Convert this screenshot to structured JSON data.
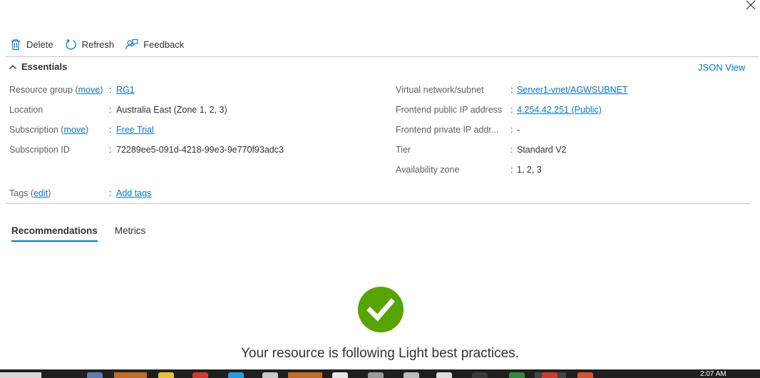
{
  "toolbar": {
    "delete_label": "Delete",
    "refresh_label": "Refresh",
    "feedback_label": "Feedback"
  },
  "essentials": {
    "title": "Essentials",
    "json_view": "JSON View",
    "left": {
      "resource_group_label": "Resource group",
      "resource_group_move": "move",
      "resource_group_value": "RG1",
      "location_label": "Location",
      "location_value": "Australia East (Zone 1, 2, 3)",
      "subscription_label": "Subscription",
      "subscription_move": "move",
      "subscription_value": "Free Trial",
      "subscription_id_label": "Subscription ID",
      "subscription_id_value": "72289ee5-091d-4218-99e3-9e770f93adc3",
      "tags_label": "Tags",
      "tags_edit": "edit",
      "tags_value": "Add tags"
    },
    "right": {
      "vnet_label": "Virtual network/subnet",
      "vnet_value": "Server1-vnet/AGWSUBNET",
      "public_ip_label": "Frontend public IP address",
      "public_ip_value": "4.254.42.251 (Public)",
      "private_ip_label": "Frontend private IP addr...",
      "private_ip_value": "-",
      "tier_label": "Tier",
      "tier_value": "Standard V2",
      "zone_label": "Availability zone",
      "zone_value": "1, 2, 3"
    }
  },
  "tabs": [
    {
      "label": "Recommendations",
      "active": true
    },
    {
      "label": "Metrics",
      "active": false
    }
  ],
  "recommendations": {
    "message": "Your resource is following Light best practices.",
    "status_color": "#57a300"
  },
  "taskbar": {
    "clock": "2:07 AM"
  },
  "colors": {
    "link": "#0078d4",
    "divider": "#c8c6c4"
  }
}
